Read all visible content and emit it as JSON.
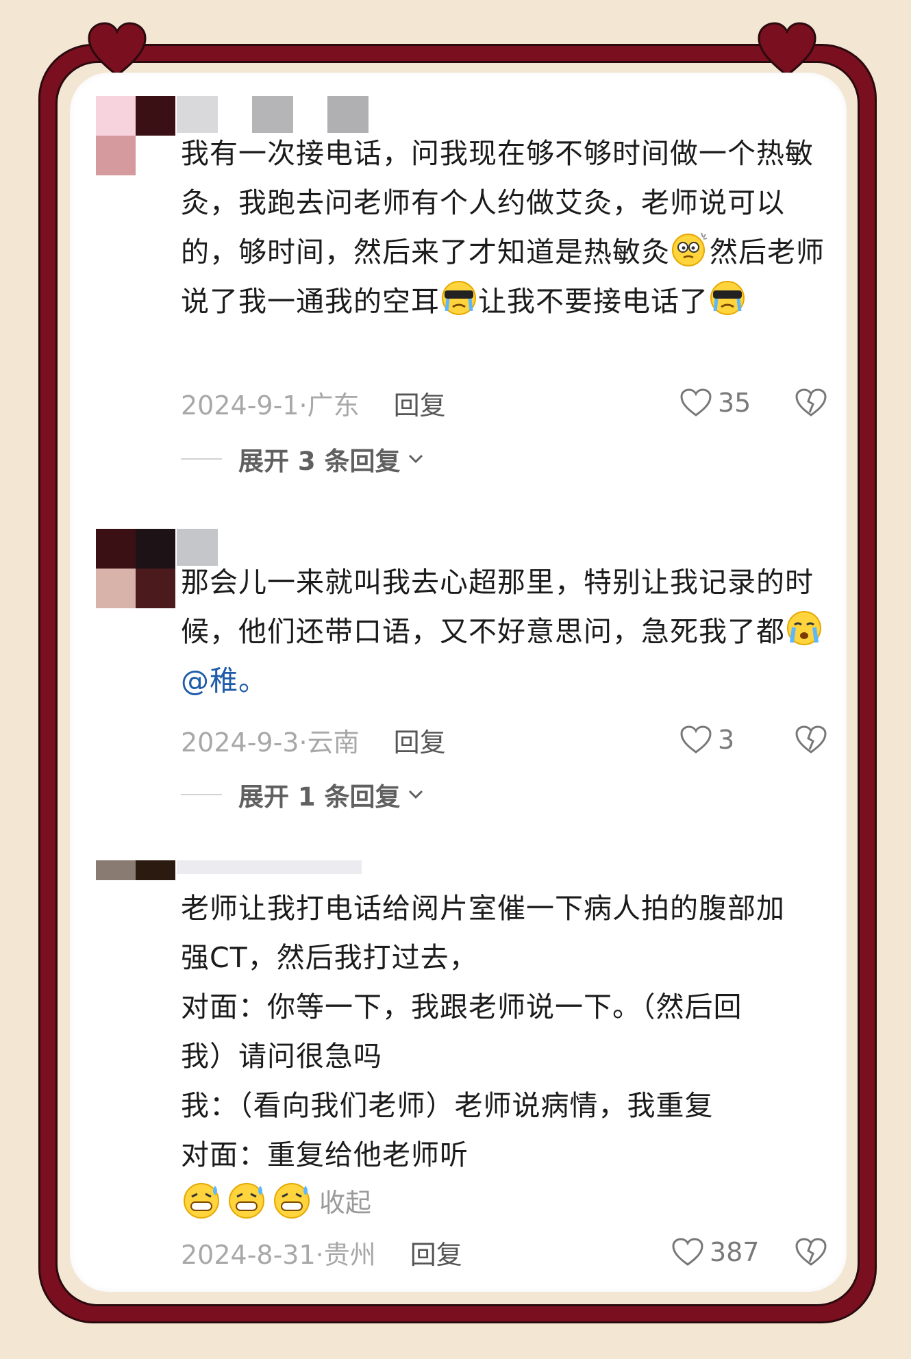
{
  "comments": [
    {
      "text": "我有一次接电话，问我现在够不够时间做一个热敏灸，我跑去问老师有个人约做艾灸，老师说可以的，够时间，然后来了才知道是热敏灸",
      "text_after_emoji1": "然后老师说了我一通我的空耳",
      "text_after_emoji2": "让我不要接电话了",
      "emojis": [
        "dizzy-face-emoji",
        "cool-crying-emoji",
        "cool-crying-emoji"
      ],
      "date": "2024-9-1·广东",
      "reply_label": "回复",
      "likes": "35",
      "expand_label": "展开 3 条回复"
    },
    {
      "text": "那会儿一来就叫我去心超那里，特别让我记录的时候，他们还带口语，又不好意思问，急死我了都",
      "mention": "@稚。",
      "emojis": [
        "crying-face-emoji"
      ],
      "date": "2024-9-3·云南",
      "reply_label": "回复",
      "likes": "3",
      "expand_label": "展开 1 条回复"
    },
    {
      "lines": [
        "老师让我打电话给阅片室催一下病人拍的腹部加",
        "强CT，然后我打过去，",
        "对面：你等一下，我跟老师说一下。（然后回",
        "我）请问很急吗",
        "我：（看向我们老师）老师说病情，我重复",
        "对面：重复给他老师听"
      ],
      "emojis": [
        "sweat-grin-emoji",
        "sweat-grin-emoji",
        "sweat-grin-emoji"
      ],
      "collapse_label": "收起",
      "date": "2024-8-31·贵州",
      "reply_label": "回复",
      "likes": "387"
    }
  ],
  "colors": {
    "frame": "#7a0f1f",
    "background": "#f3e6d3",
    "mention": "#1e5ba8"
  }
}
